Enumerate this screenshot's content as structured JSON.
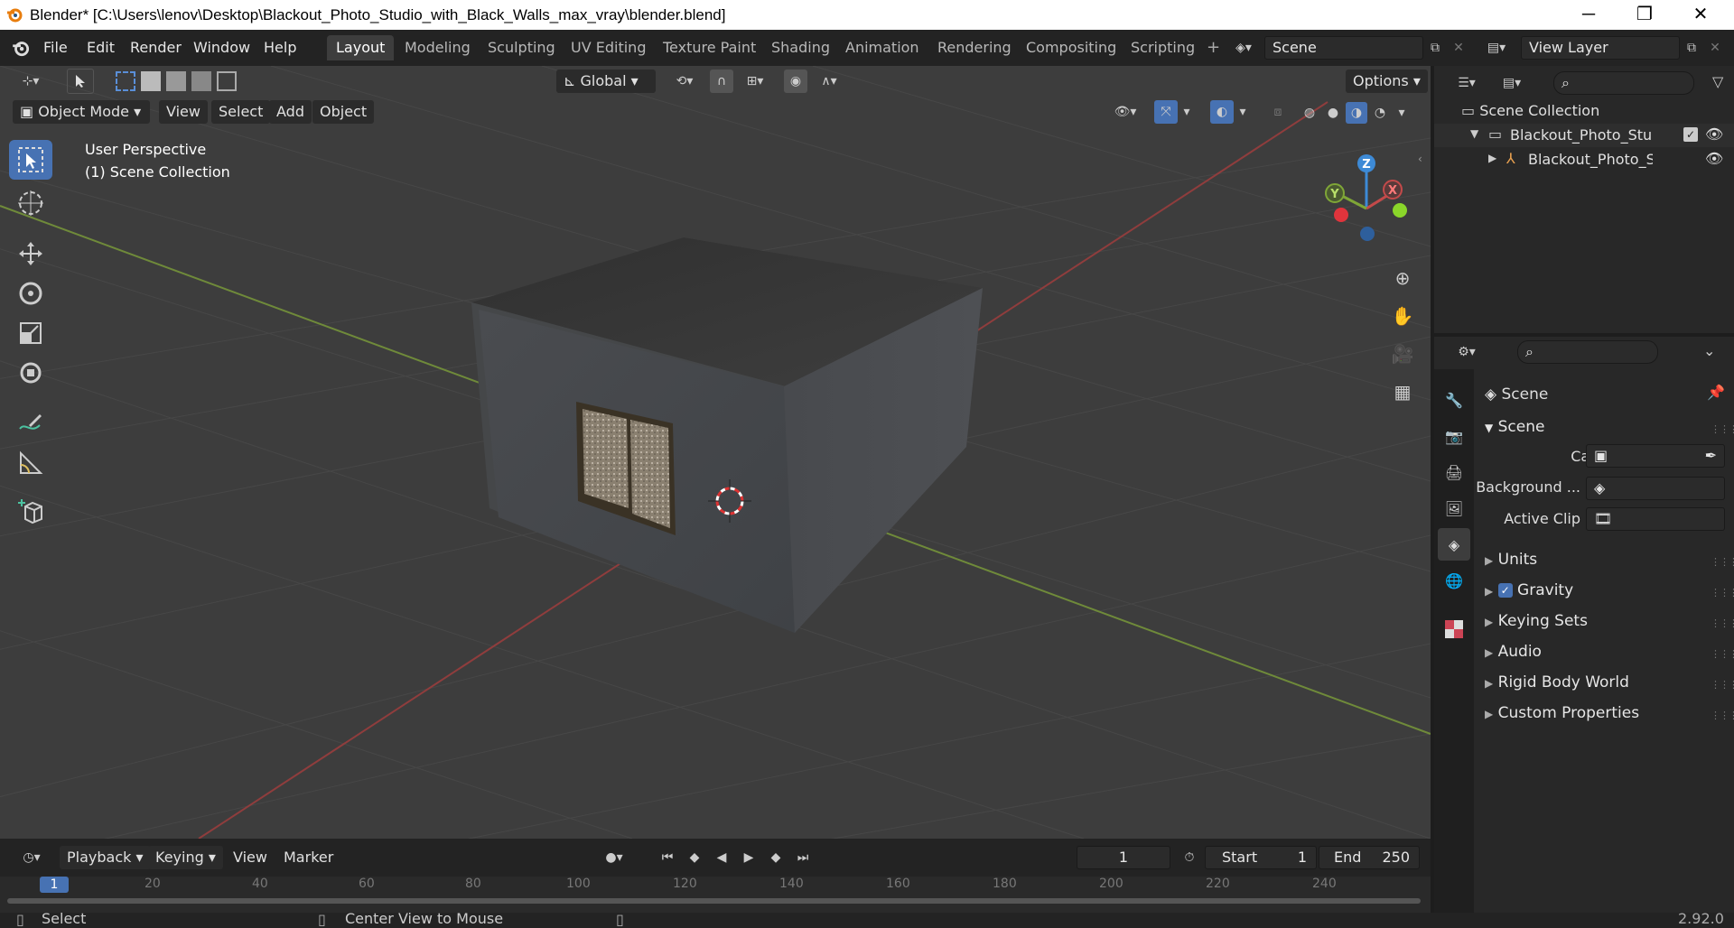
{
  "window": {
    "title": "Blender* [C:\\Users\\lenov\\Desktop\\Blackout_Photo_Studio_with_Black_Walls_max_vray\\blender.blend]",
    "minimize": "─",
    "maximize": "❐",
    "close": "✕"
  },
  "menu": [
    "File",
    "Edit",
    "Render",
    "Window",
    "Help"
  ],
  "workspaces": [
    "Layout",
    "Modeling",
    "Sculpting",
    "UV Editing",
    "Texture Paint",
    "Shading",
    "Animation",
    "Rendering",
    "Compositing",
    "Scripting"
  ],
  "active_workspace": "Layout",
  "scene_field": "Scene",
  "view_layer_field": "View Layer",
  "viewport": {
    "transform_orientation": "Global",
    "options_label": "Options",
    "mode": "Object Mode",
    "header_menus": [
      "View",
      "Select",
      "Add",
      "Object"
    ],
    "overlay_line1": "User Perspective",
    "overlay_line2": "(1) Scene Collection",
    "gizmo_axes": [
      "X",
      "Y",
      "Z"
    ],
    "colors": {
      "x_axis": "#c34a4a",
      "y_axis": "#7fa637",
      "z_axis": "#3d8ad6",
      "bg": "#3d3d3d",
      "grid": "#4a4a4a"
    }
  },
  "outliner": {
    "search_placeholder": "",
    "root": "Scene Collection",
    "items": [
      "Blackout_Photo_Studio_w",
      "Blackout_Photo_Stuc"
    ]
  },
  "properties": {
    "header": "Scene",
    "panel": "Scene",
    "fields": [
      {
        "label": "Camera"
      },
      {
        "label": "Background ..."
      },
      {
        "label": "Active Clip"
      }
    ],
    "subpanels": [
      "Units",
      "Gravity",
      "Keying Sets",
      "Audio",
      "Rigid Body World",
      "Custom Properties"
    ],
    "gravity_checked": true
  },
  "timeline": {
    "menus": [
      "Playback",
      "Keying",
      "View",
      "Marker"
    ],
    "current_frame": "1",
    "start_label": "Start",
    "start": "1",
    "end_label": "End",
    "end": "250",
    "ruler": [
      "1",
      "20",
      "40",
      "60",
      "80",
      "100",
      "120",
      "140",
      "160",
      "180",
      "200",
      "220",
      "240"
    ]
  },
  "status": {
    "select": "Select",
    "center_view": "Center View to Mouse",
    "version": "2.92.0"
  }
}
